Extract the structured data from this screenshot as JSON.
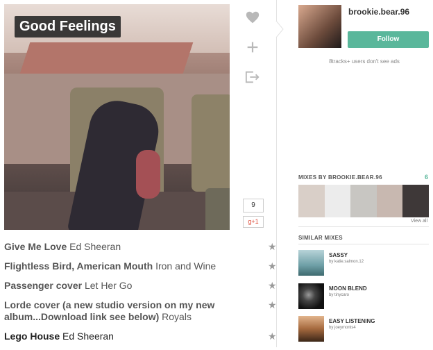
{
  "mix": {
    "title": "Good Feelings",
    "like_count": "9",
    "gplus_label": "g+1"
  },
  "actions": {
    "like_icon": "heart-icon",
    "add_icon": "plus-icon",
    "share_icon": "export-icon"
  },
  "tracks": [
    {
      "title": "Give Me Love",
      "artist": "Ed Sheeran"
    },
    {
      "title": "Flightless Bird, American Mouth",
      "artist": "Iron and Wine"
    },
    {
      "title": "Passenger cover",
      "artist": "Let Her Go"
    },
    {
      "title": "Lorde cover (a new studio version on my new album...Download link see below)",
      "artist": "Royals"
    },
    {
      "title": "Lego House",
      "artist": "Ed Sheeran"
    }
  ],
  "user": {
    "name": "brookie.bear.96",
    "follow_label": "Follow",
    "ads_note": "8tracks+ users don't see ads"
  },
  "mixes_by": {
    "heading": "MIXES BY BROOKIE.BEAR.96",
    "count": "6",
    "view_all": "View all"
  },
  "similar": {
    "heading": "SIMILAR MIXES",
    "items": [
      {
        "title": "SASSY",
        "by": "by katie.salmon.12"
      },
      {
        "title": "MOON BLEND",
        "by": "by tinycaro"
      },
      {
        "title": "EASY LISTENING",
        "by": "by joeymonts4"
      }
    ]
  },
  "colors": {
    "accent": "#5ab79b"
  }
}
